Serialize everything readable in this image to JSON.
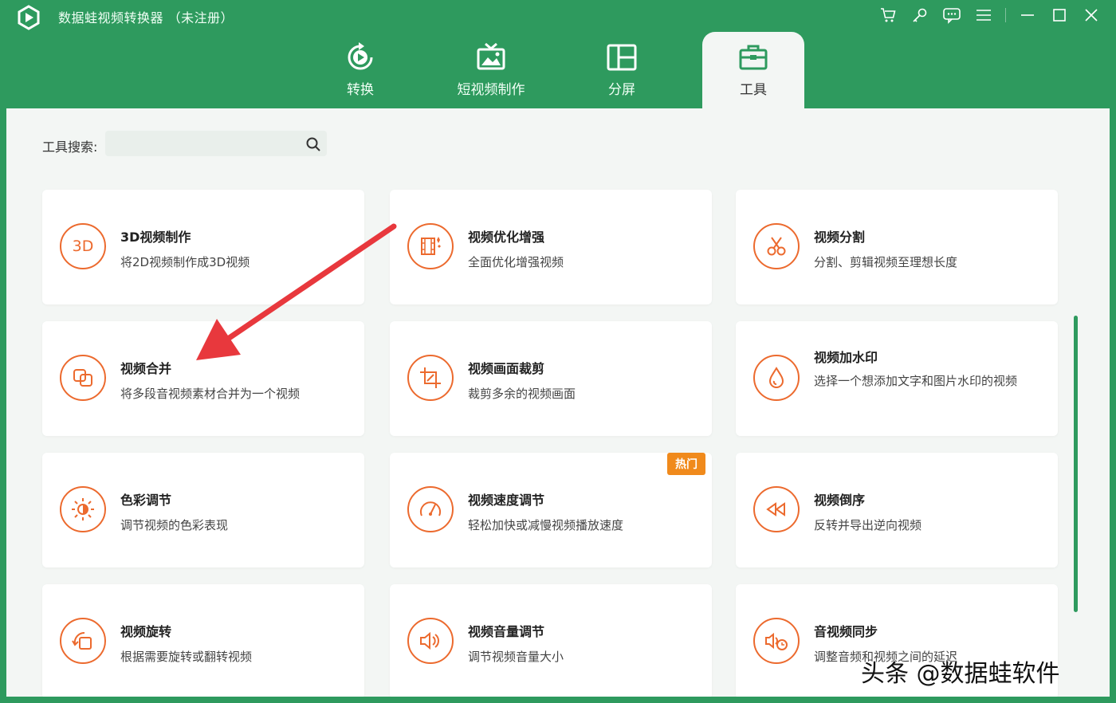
{
  "app": {
    "title": "数据蛙视频转换器 （未注册）"
  },
  "tabs": [
    {
      "label": "转换",
      "icon": "convert-icon"
    },
    {
      "label": "短视频制作",
      "icon": "tv-icon"
    },
    {
      "label": "分屏",
      "icon": "split-screen-icon"
    },
    {
      "label": "工具",
      "icon": "toolbox-icon",
      "active": true
    }
  ],
  "search": {
    "label": "工具搜索:",
    "value": "",
    "placeholder": ""
  },
  "tools": [
    {
      "title": "3D视频制作",
      "desc": "将2D视频制作成3D视频",
      "icon": "3d-icon"
    },
    {
      "title": "视频优化增强",
      "desc": "全面优化增强视频",
      "icon": "film-enhance-icon"
    },
    {
      "title": "视频分割",
      "desc": "分割、剪辑视频至理想长度",
      "icon": "scissors-icon"
    },
    {
      "title": "视频合并",
      "desc": "将多段音视频素材合并为一个视频",
      "icon": "merge-icon"
    },
    {
      "title": "视频画面裁剪",
      "desc": "裁剪多余的视频画面",
      "icon": "crop-icon"
    },
    {
      "title": "视频加水印",
      "desc": "选择一个想添加文字和图片水印的视频",
      "icon": "watermark-drop-icon"
    },
    {
      "title": "色彩调节",
      "desc": "调节视频的色彩表现",
      "icon": "color-sun-icon"
    },
    {
      "title": "视频速度调节",
      "desc": "轻松加快或减慢视频播放速度",
      "icon": "speedometer-icon",
      "badge": "热门"
    },
    {
      "title": "视频倒序",
      "desc": "反转并导出逆向视频",
      "icon": "rewind-icon"
    },
    {
      "title": "视频旋转",
      "desc": "根据需要旋转或翻转视频",
      "icon": "rotate-icon"
    },
    {
      "title": "视频音量调节",
      "desc": "调节视频音量大小",
      "icon": "volume-icon"
    },
    {
      "title": "音视频同步",
      "desc": "调整音频和视频之间的延迟",
      "icon": "av-sync-icon"
    }
  ],
  "watermark": "头条 @数据蛙软件",
  "colors": {
    "brand": "#2e9a5e",
    "accent": "#ec6a2e",
    "hot": "#f08a1c",
    "arrow": "#e8383d"
  }
}
